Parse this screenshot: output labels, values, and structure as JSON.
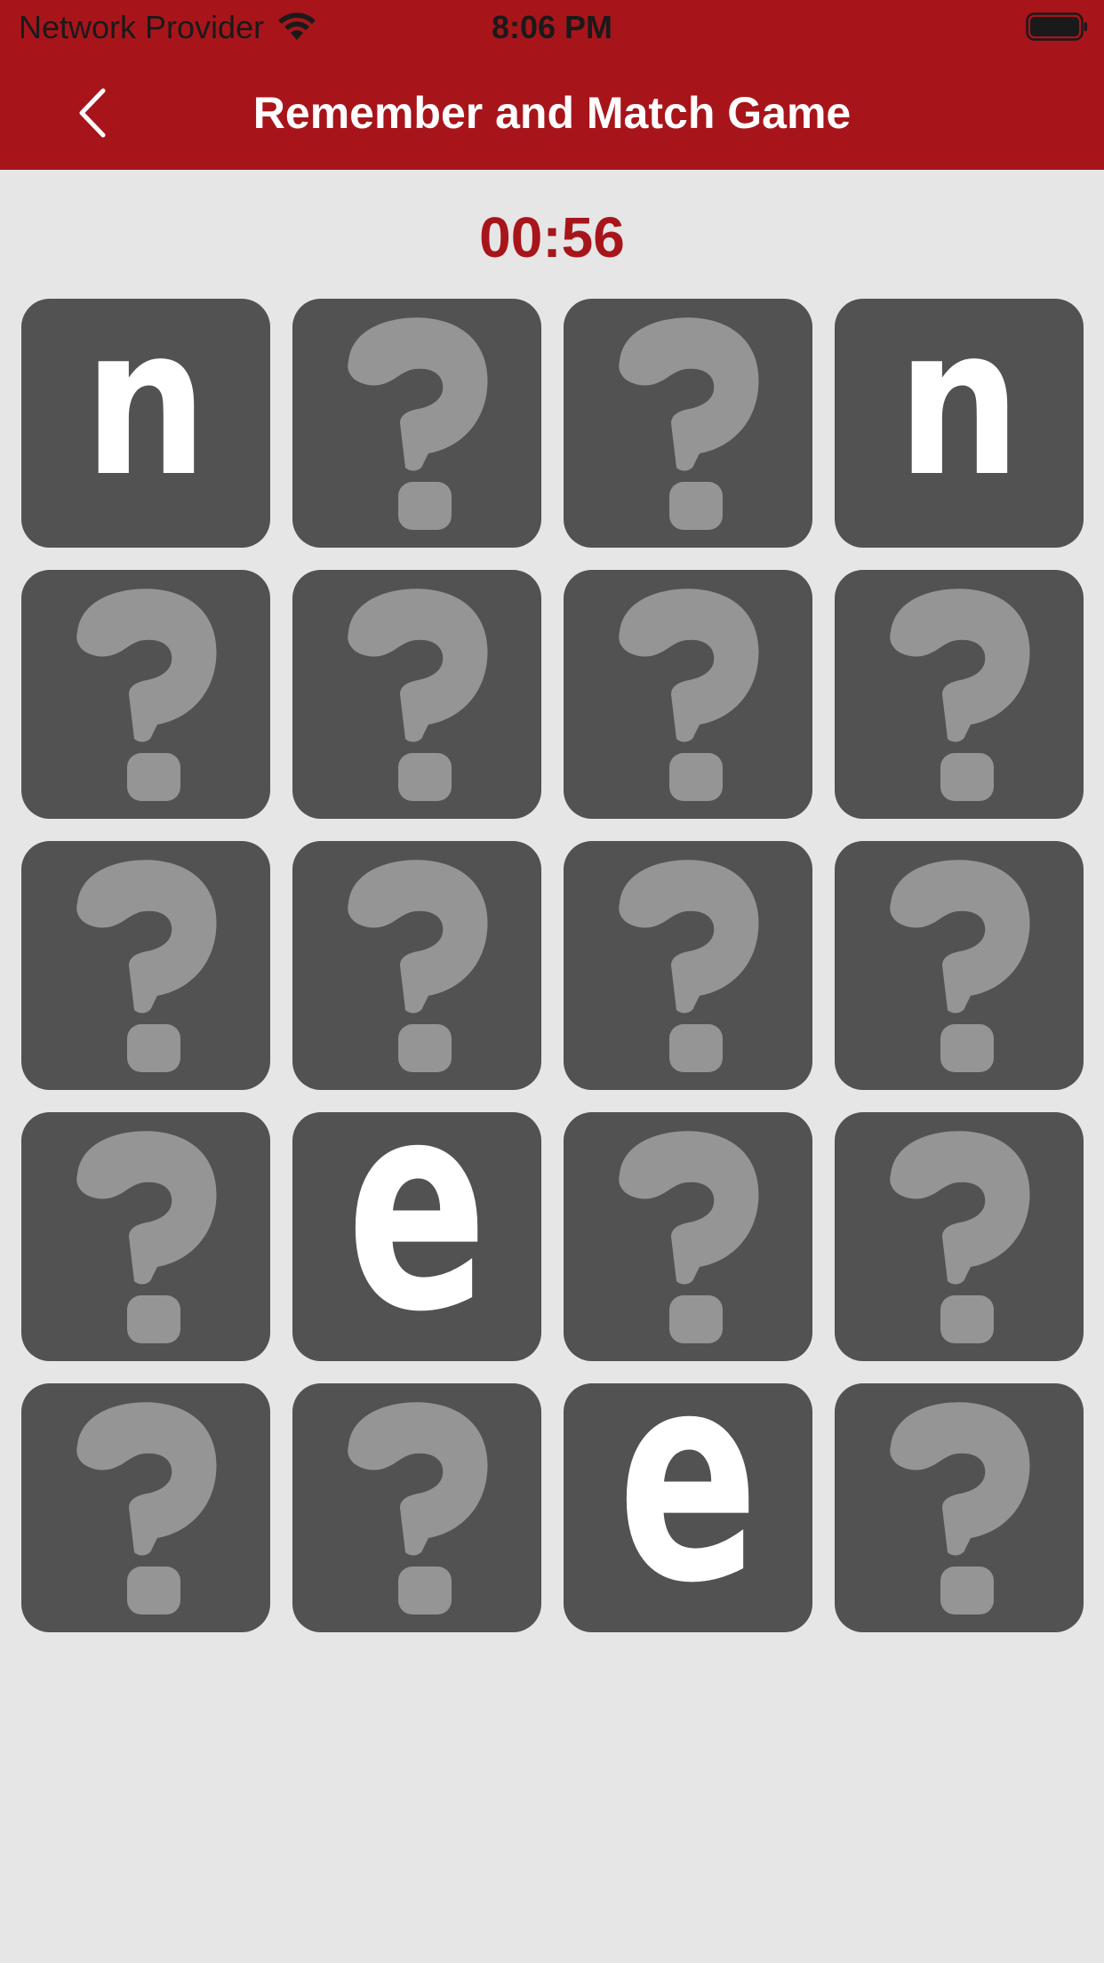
{
  "status_bar": {
    "carrier": "Network Provider",
    "time": "8:06 PM",
    "wifi_icon": "wifi-icon",
    "battery_icon": "battery-icon"
  },
  "header": {
    "title": "Remember and Match Game",
    "back_icon": "chevron-left-icon"
  },
  "game": {
    "timer": "00:56",
    "columns": 4,
    "cards": [
      {
        "state": "revealed",
        "letter": "n"
      },
      {
        "state": "hidden",
        "letter": ""
      },
      {
        "state": "hidden",
        "letter": ""
      },
      {
        "state": "revealed",
        "letter": "n"
      },
      {
        "state": "hidden",
        "letter": ""
      },
      {
        "state": "hidden",
        "letter": ""
      },
      {
        "state": "hidden",
        "letter": ""
      },
      {
        "state": "hidden",
        "letter": ""
      },
      {
        "state": "hidden",
        "letter": ""
      },
      {
        "state": "hidden",
        "letter": ""
      },
      {
        "state": "hidden",
        "letter": ""
      },
      {
        "state": "hidden",
        "letter": ""
      },
      {
        "state": "hidden",
        "letter": ""
      },
      {
        "state": "revealed",
        "letter": "e"
      },
      {
        "state": "hidden",
        "letter": ""
      },
      {
        "state": "hidden",
        "letter": ""
      },
      {
        "state": "hidden",
        "letter": ""
      },
      {
        "state": "hidden",
        "letter": ""
      },
      {
        "state": "revealed",
        "letter": "e"
      },
      {
        "state": "hidden",
        "letter": ""
      }
    ]
  },
  "colors": {
    "header_bg": "#a7151b",
    "timer_text": "#a7151b",
    "card_bg": "#525252",
    "question_mark": "#959595",
    "page_bg": "#e6e6e6"
  }
}
